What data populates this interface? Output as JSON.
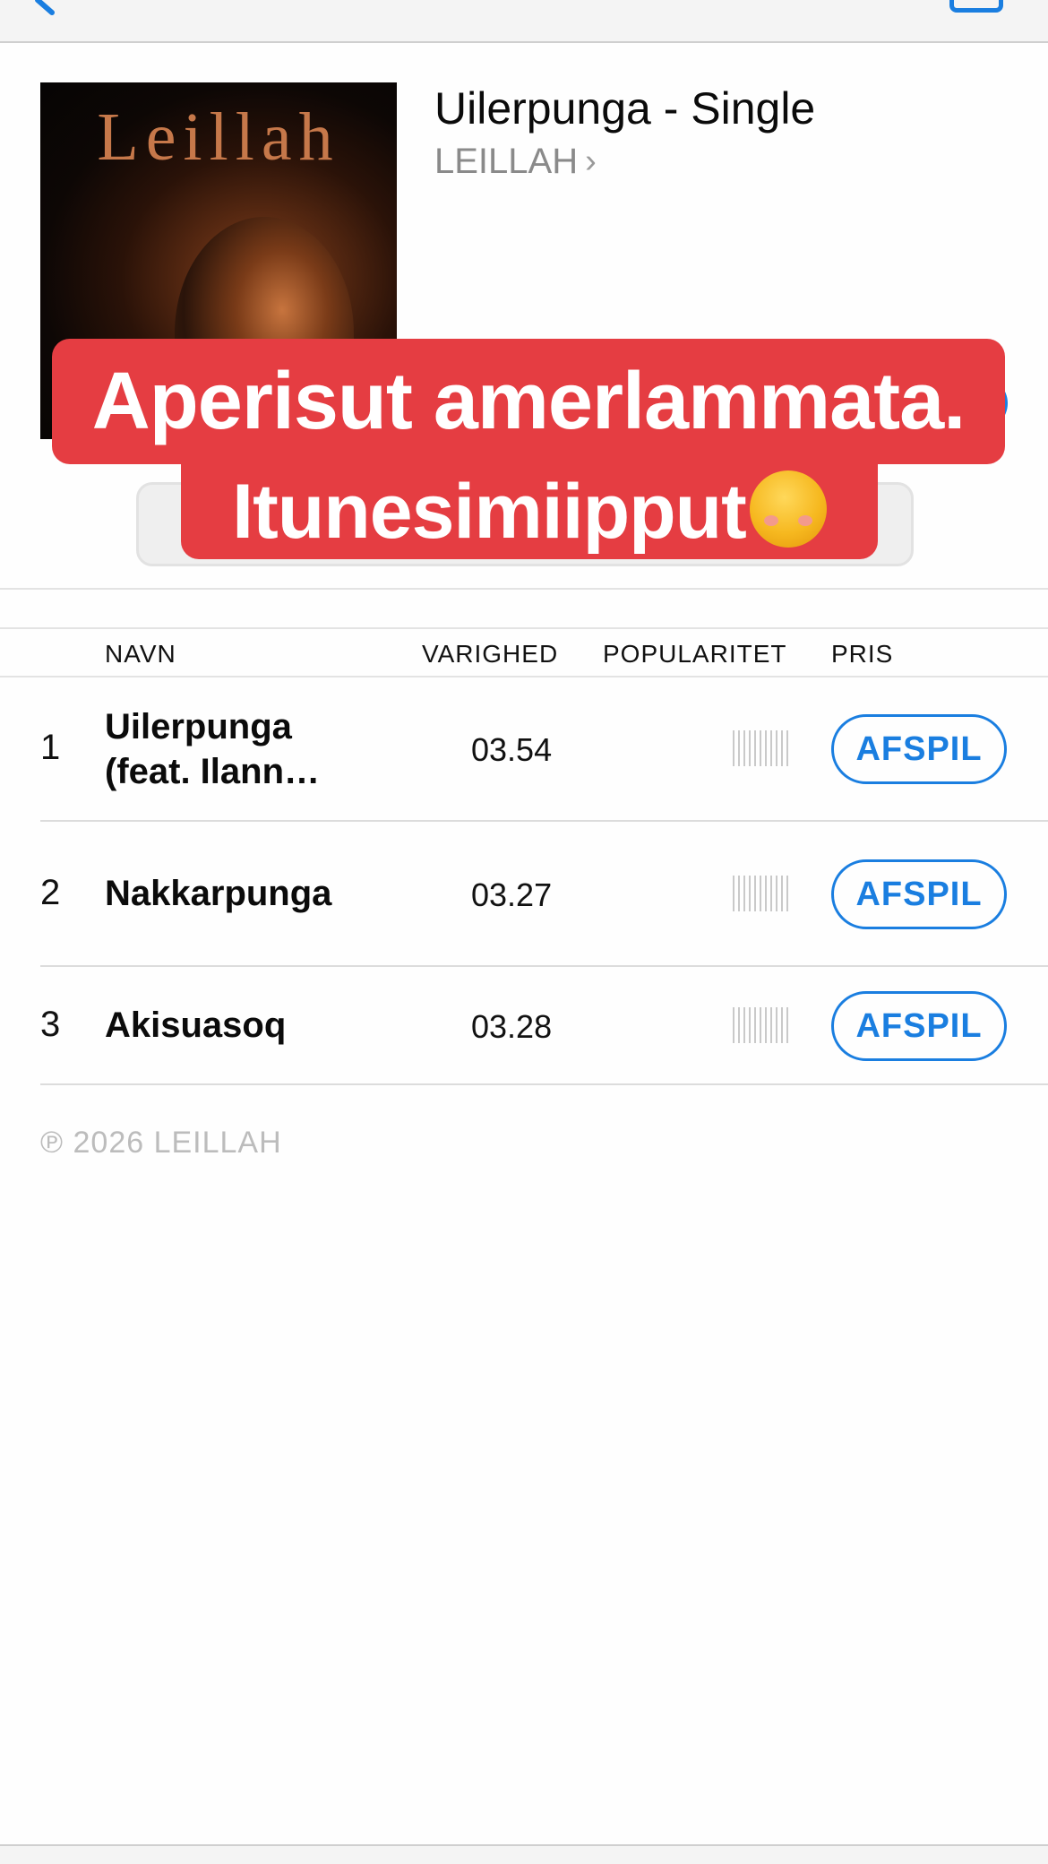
{
  "album": {
    "title": "Uilerpunga - Single",
    "artist": "LEILLAH",
    "artist_chevron": "›",
    "cover_text": "Leillah"
  },
  "overlay": {
    "line1": "Aperisut amerlammata.",
    "line2": "Itunesimiipput",
    "emoji": "smiling-face-with-blush"
  },
  "table": {
    "columns": [
      "NAVN",
      "VARIGHED",
      "POPULARITET",
      "PRIS"
    ],
    "tracks": [
      {
        "num": "1",
        "name_line1": "Uilerpunga",
        "name_line2": "(feat. Ilann…",
        "duration": "03.54",
        "button": "AFSPIL"
      },
      {
        "num": "2",
        "name_line1": "Nakkarpunga",
        "name_line2": "",
        "duration": "03.27",
        "button": "AFSPIL"
      },
      {
        "num": "3",
        "name_line1": "Akisuasoq",
        "name_line2": "",
        "duration": "03.28",
        "button": "AFSPIL"
      }
    ]
  },
  "footer": {
    "copyright": "℗ 2026 LEILLAH"
  },
  "colors": {
    "accent": "#1a7ee0",
    "banner": "#e53d42",
    "muted": "#8a8a8a"
  }
}
